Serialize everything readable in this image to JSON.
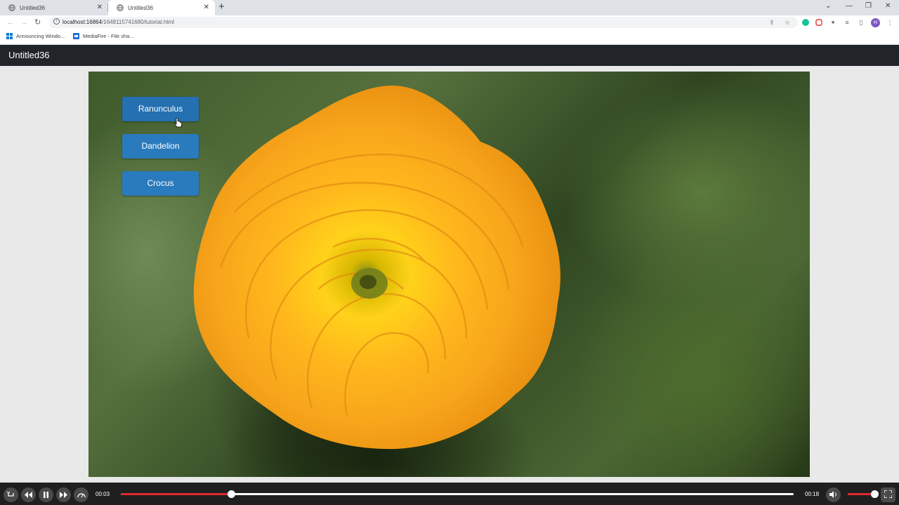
{
  "browser": {
    "tabs": [
      {
        "title": "Untitled36",
        "active": false
      },
      {
        "title": "Untitled36",
        "active": true
      }
    ],
    "new_tab_icon": "plus-icon",
    "url_host": "localhost:16864",
    "url_path": "/1648115741680/tutorial.html",
    "profile_initial": "H",
    "bookmarks": [
      {
        "label": "Announcing Windo...",
        "icon": "windows-icon"
      },
      {
        "label": "MediaFire - File sha...",
        "icon": "mediafire-icon"
      }
    ]
  },
  "app": {
    "brand": "Untitled36",
    "nav_color": "#212529"
  },
  "buttons": [
    {
      "label": "Ranunculus"
    },
    {
      "label": "Dandelion"
    },
    {
      "label": "Crocus"
    }
  ],
  "button_color": "#2a7bbd",
  "image": {
    "subject": "yellow-ranunculus-flower"
  },
  "player": {
    "current_time": "00:03",
    "duration": "00:18",
    "progress": 0.164,
    "volume": 1.0,
    "accent_color": "#e0292f"
  }
}
